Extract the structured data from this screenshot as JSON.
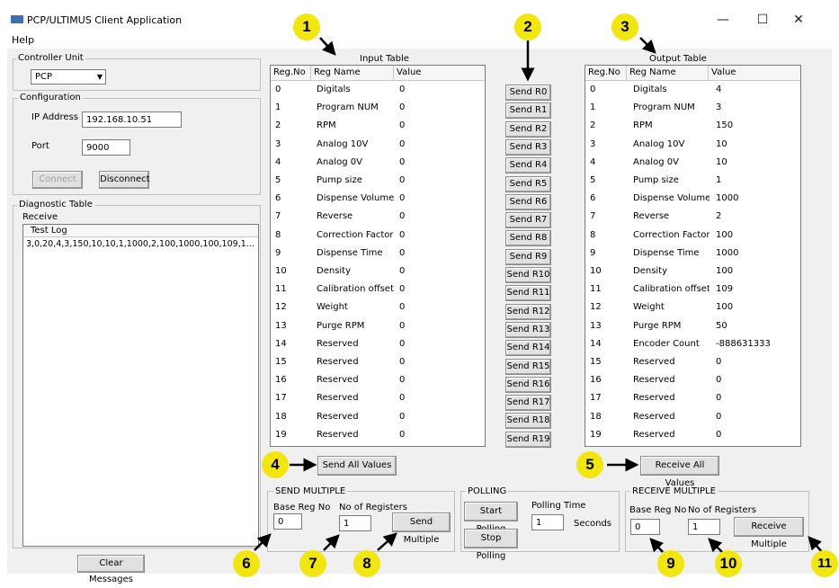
{
  "window": {
    "title": "PCP/ULTIMUS Client Application",
    "minimize": "—",
    "maximize": "☐",
    "close": "✕"
  },
  "menu": {
    "help": "Help"
  },
  "controller_unit": {
    "label": "Controller Unit",
    "selected": "PCP"
  },
  "configuration": {
    "label": "Configuration",
    "ip_label": "IP Address",
    "ip_value": "192.168.10.51",
    "port_label": "Port",
    "port_value": "9000",
    "connect": "Connect",
    "disconnect": "Disconnect"
  },
  "diagnostic": {
    "label": "Diagnostic Table",
    "receive": "Receive",
    "log_header": "Test Log",
    "log_line": "3,0,20,4,3,150,10,10,1,1000,2,100,1000,100,109,1...",
    "clear": "Clear Messages"
  },
  "input_table": {
    "caption": "Input Table",
    "headers": [
      "Reg.No",
      "Reg Name",
      "Value"
    ],
    "rows": [
      [
        "0",
        "Digitals",
        "0"
      ],
      [
        "1",
        "Program NUM",
        "0"
      ],
      [
        "2",
        "RPM",
        "0"
      ],
      [
        "3",
        "Analog 10V",
        "0"
      ],
      [
        "4",
        "Analog 0V",
        "0"
      ],
      [
        "5",
        "Pump size",
        "0"
      ],
      [
        "6",
        "Dispense Volume",
        "0"
      ],
      [
        "7",
        "Reverse",
        "0"
      ],
      [
        "8",
        "Correction Factor",
        "0"
      ],
      [
        "9",
        "Dispense Time",
        "0"
      ],
      [
        "10",
        "Density",
        "0"
      ],
      [
        "11",
        "Calibration offset",
        "0"
      ],
      [
        "12",
        "Weight",
        "0"
      ],
      [
        "13",
        "Purge RPM",
        "0"
      ],
      [
        "14",
        "Reserved",
        "0"
      ],
      [
        "15",
        "Reserved",
        "0"
      ],
      [
        "16",
        "Reserved",
        "0"
      ],
      [
        "17",
        "Reserved",
        "0"
      ],
      [
        "18",
        "Reserved",
        "0"
      ],
      [
        "19",
        "Reserved",
        "0"
      ]
    ]
  },
  "send_buttons": [
    "Send R0",
    "Send R1",
    "Send R2",
    "Send R3",
    "Send R4",
    "Send R5",
    "Send R6",
    "Send R7",
    "Send R8",
    "Send R9",
    "Send R10",
    "Send R11",
    "Send R12",
    "Send R13",
    "Send R14",
    "Send R15",
    "Send R16",
    "Send R17",
    "Send R18",
    "Send R19"
  ],
  "output_table": {
    "caption": "Output Table",
    "headers": [
      "Reg.No",
      "Reg Name",
      "Value"
    ],
    "rows": [
      [
        "0",
        "Digitals",
        "4"
      ],
      [
        "1",
        "Program NUM",
        "3"
      ],
      [
        "2",
        "RPM",
        "150"
      ],
      [
        "3",
        "Analog 10V",
        "10"
      ],
      [
        "4",
        "Analog 0V",
        "10"
      ],
      [
        "5",
        "Pump size",
        "1"
      ],
      [
        "6",
        "Dispense Volume",
        "1000"
      ],
      [
        "7",
        "Reverse",
        "2"
      ],
      [
        "8",
        "Correction Factor",
        "100"
      ],
      [
        "9",
        "Dispense Time",
        "1000"
      ],
      [
        "10",
        "Density",
        "100"
      ],
      [
        "11",
        "Calibration offset",
        "109"
      ],
      [
        "12",
        "Weight",
        "100"
      ],
      [
        "13",
        "Purge RPM",
        "50"
      ],
      [
        "14",
        "Encoder Count",
        "-888631333"
      ],
      [
        "15",
        "Reserved",
        "0"
      ],
      [
        "16",
        "Reserved",
        "0"
      ],
      [
        "17",
        "Reserved",
        "0"
      ],
      [
        "18",
        "Reserved",
        "0"
      ],
      [
        "19",
        "Reserved",
        "0"
      ]
    ]
  },
  "send_all": "Send All Values",
  "receive_all": "Receive All Values",
  "send_multiple": {
    "label": "SEND MULTIPLE",
    "base_label": "Base Reg No",
    "base_value": "0",
    "count_label": "No of Registers",
    "count_value": "1",
    "button": "Send Multiple"
  },
  "polling": {
    "label": "POLLING",
    "start": "Start Polling",
    "stop": "Stop Polling",
    "time_label": "Polling Time",
    "time_value": "1",
    "unit": "Seconds"
  },
  "receive_multiple": {
    "label": "RECEIVE MULTIPLE",
    "base_label": "Base Reg No",
    "base_value": "0",
    "count_label": "No of Registers",
    "count_value": "1",
    "button": "Receive Multiple"
  },
  "callouts": [
    "1",
    "2",
    "3",
    "4",
    "5",
    "6",
    "7",
    "8",
    "9",
    "10",
    "11"
  ],
  "colors": {
    "callout": "#f2e60f",
    "window_bg": "#f0f0f0"
  }
}
